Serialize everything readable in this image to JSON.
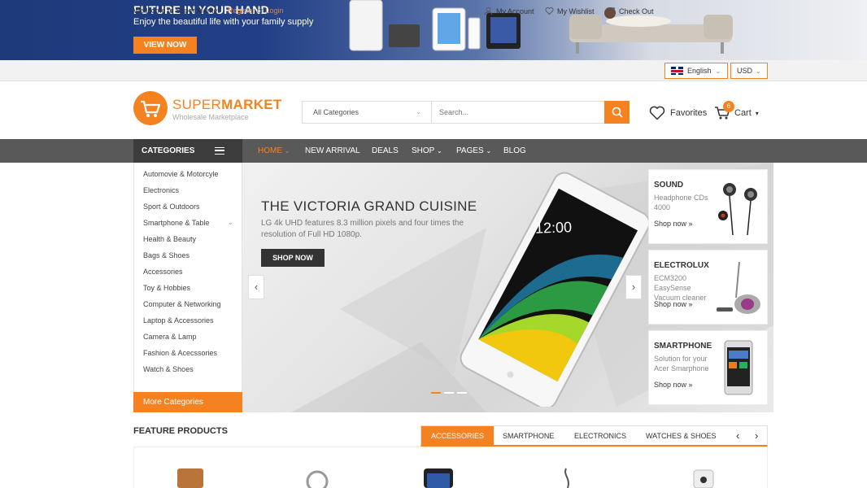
{
  "promo": {
    "title": "FUTURE IN YOUR HAND",
    "subtitle": "Enjoy the beautiful life with your family supply",
    "button": "VIEW NOW"
  },
  "topbar": {
    "welcome": "Wellcome to Super Market",
    "register": "Register",
    "or": "or",
    "login": "Login",
    "my_account": "My Account",
    "my_wishlist": "My Wishlist",
    "checkout": "Check Out",
    "language": "English",
    "currency": "USD"
  },
  "header": {
    "logo_super": "SUPER",
    "logo_market": "MARKET",
    "logo_tagline": "Wholesale Marketplace",
    "search_category": "All Categories",
    "search_placeholder": "Search...",
    "favorites": "Favorites",
    "cart": "Cart",
    "cart_count": "6"
  },
  "nav": {
    "categories_label": "CATEGORIES",
    "items": [
      "HOME",
      "NEW ARRIVAL",
      "DEALS",
      "SHOP",
      "PAGES",
      "BLOG"
    ]
  },
  "categories": [
    "Automovie & Motorcyle",
    "Electronics",
    "Sport & Outdoors",
    "Smartphone & Table",
    "Health & Beauty",
    "Bags & Shoes",
    "Accessories",
    "Toy & Hobbies",
    "Computer & Networking",
    "Laptop & Accessories",
    "Camera & Lamp",
    "Fashion & Acecssories",
    "Watch & Shoes"
  ],
  "more_categories": "More Categories",
  "slider": {
    "title": "THE VICTORIA GRAND CUISINE",
    "description": "LG 4k UHD features 8.3 million pixels and four times the resolution of Full HD 1080p.",
    "button": "SHOP NOW",
    "phone_time": "12:00",
    "prev": "‹",
    "next": "›"
  },
  "side_promos": [
    {
      "title": "SOUND",
      "desc": "Headphone CDs 4000",
      "link": "Shop now »"
    },
    {
      "title": "ELECTROLUX",
      "desc": "ECM3200 EasySense Vacuum cleaner",
      "link": "Shop now »"
    },
    {
      "title": "SMARTPHONE",
      "desc": "Solution for your Acer Smarphone",
      "link": "Shop now »"
    }
  ],
  "feature": {
    "title": "FEATURE PRODUCTS",
    "tabs": [
      "ACCESSORIES",
      "SMARTPHONE",
      "ELECTRONICS",
      "WATCHES & SHOES"
    ],
    "prev": "‹",
    "next": "›"
  },
  "colors": {
    "accent": "#f58220",
    "nav": "#595959",
    "nav_dark": "#3c3c3c",
    "promo_blue": "#223f86"
  }
}
